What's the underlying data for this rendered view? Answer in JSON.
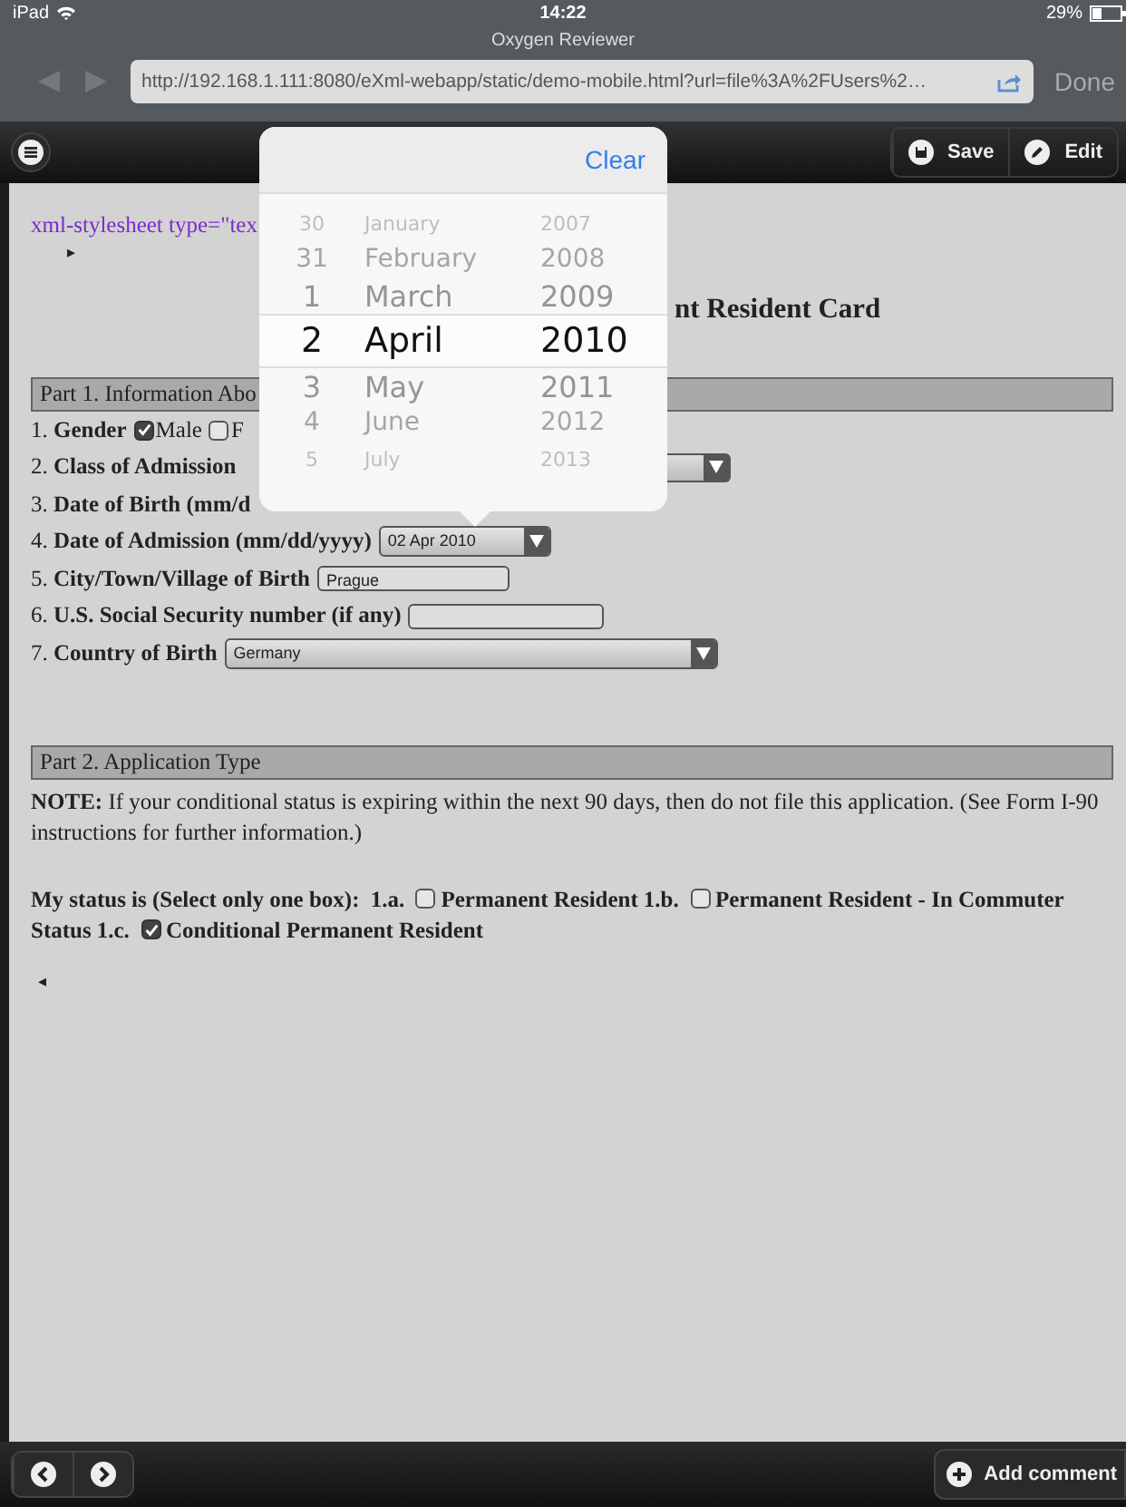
{
  "status_bar": {
    "device": "iPad",
    "time": "14:22",
    "battery": "29%"
  },
  "browser": {
    "title": "Oxygen Reviewer",
    "url": "http://192.168.1.111:8080/eXml-webapp/static/demo-mobile.html?url=file%3A%2FUsers%2…",
    "back_disabled": true,
    "forward_disabled": true,
    "done": "Done"
  },
  "toolbar": {
    "buttons": [
      {
        "kind": "save",
        "label": "Save"
      },
      {
        "kind": "edit",
        "label": "Edit"
      }
    ]
  },
  "document": {
    "pi": "xml-stylesheet type=\"tex",
    "toggle": "▸",
    "title": "nt Resident Card",
    "part1": {
      "heading": "Part 1. Information Abo",
      "rows": [
        {
          "kind": "gender",
          "label": "1. **Gender**",
          "options": [
            {
              "label": "Male",
              "checked": true
            },
            {
              "label": "F",
              "checked": false
            }
          ]
        },
        {
          "kind": "select_tail",
          "label": "2. **Class of Admission**"
        },
        {
          "kind": "plain",
          "label": "3. **Date of Birth  (mm/d**"
        },
        {
          "kind": "date",
          "label": "4. **Date of Admission (mm/dd/yyyy)**",
          "value": "02 Apr 2010"
        },
        {
          "kind": "input",
          "label": "5. **City/Town/Village of Birth**",
          "value": "Prague"
        },
        {
          "kind": "input",
          "label": "6. **U.S. Social Security number (if any)**",
          "value": ""
        },
        {
          "kind": "select",
          "label": "7. **Country of Birth**",
          "value": "Germany"
        }
      ]
    },
    "part2": {
      "heading": "Part 2. Application Type",
      "note": "**NOTE:** If your conditional status is expiring within the next 90 days, then do not file this application. (See Form I-90 instructions for further information.)",
      "status_lead": "My status is (Select only one box):",
      "options": [
        {
          "prefix": "1.a.",
          "label_lines": [
            "Permanent Resident"
          ],
          "checked": false
        },
        {
          "prefix": "1.b.",
          "label_lines": [
            "Permanent Resident - In Commuter",
            "Status"
          ],
          "checked": false
        },
        {
          "prefix": "1.c.",
          "label_lines": [
            "Conditional Permanent Resident"
          ],
          "checked": true
        }
      ]
    },
    "toggle_end": "◂"
  },
  "picker": {
    "clear": "Clear",
    "rows": [
      {
        "day": "30",
        "month": "January",
        "year": "2007",
        "selected": false
      },
      {
        "day": "31",
        "month": "February",
        "year": "2008",
        "selected": false
      },
      {
        "day": "1",
        "month": "March",
        "year": "2009",
        "selected": false
      },
      {
        "day": "2",
        "month": "April",
        "year": "2010",
        "selected": true
      },
      {
        "day": "3",
        "month": "May",
        "year": "2011",
        "selected": false
      },
      {
        "day": "4",
        "month": "June",
        "year": "2012",
        "selected": false
      },
      {
        "day": "5",
        "month": "July",
        "year": "2013",
        "selected": false
      }
    ]
  },
  "bottom_bar": {
    "add_comment": "Add comment"
  }
}
